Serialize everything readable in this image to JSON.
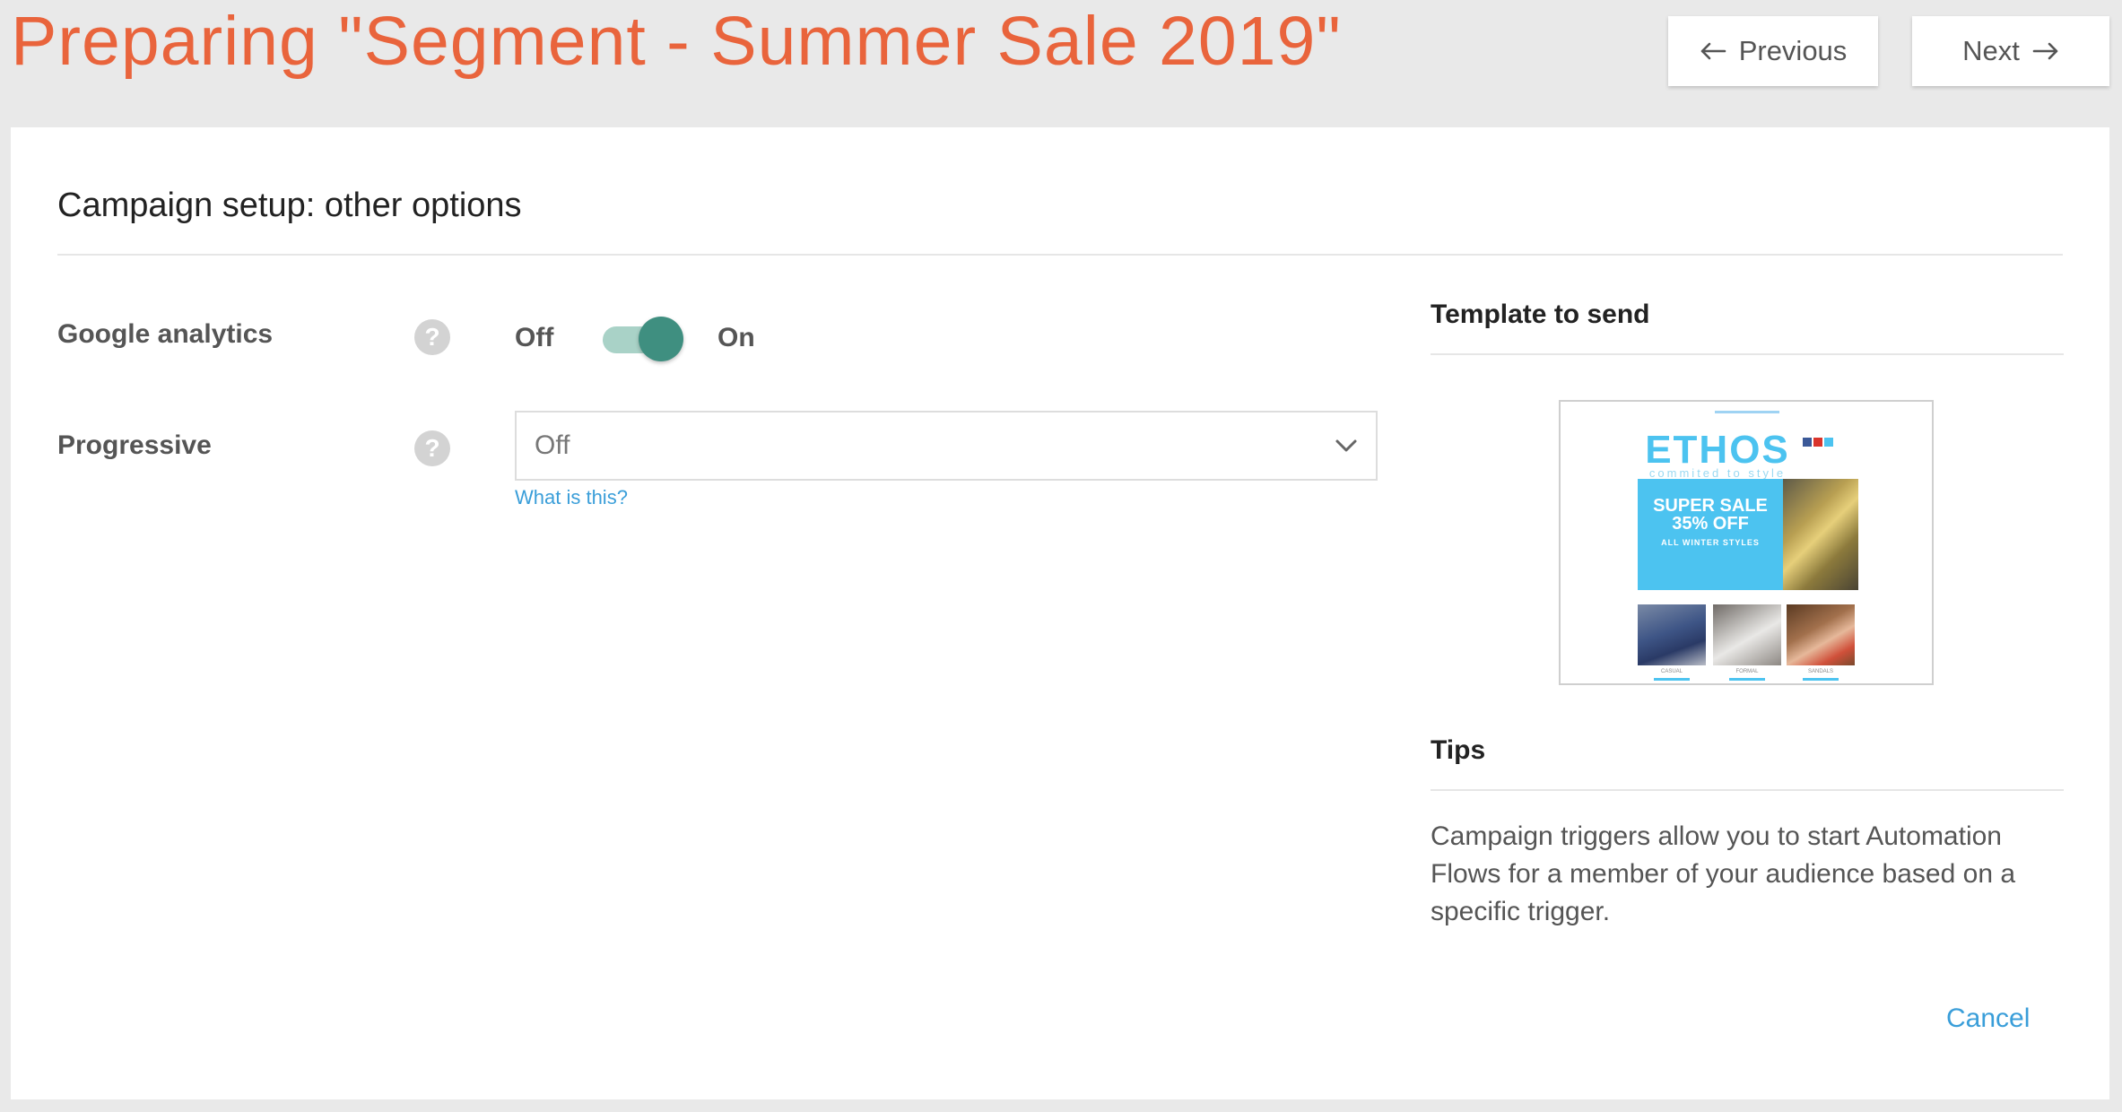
{
  "header": {
    "title": "Preparing \"Segment - Summer Sale 2019\"",
    "previous_label": "Previous",
    "next_label": "Next"
  },
  "section": {
    "title": "Campaign setup: other options"
  },
  "fields": {
    "google_analytics": {
      "label": "Google analytics",
      "help_icon": "?",
      "off_label": "Off",
      "on_label": "On",
      "enabled": true
    },
    "progressive": {
      "label": "Progressive",
      "help_icon": "?",
      "selected_value": "Off",
      "help_link": "What is this?"
    }
  },
  "sidebar": {
    "template_heading": "Template to send",
    "template_preview": {
      "brand": "ETHOS",
      "tagline": "commited to style",
      "hero_line1": "SUPER SALE",
      "hero_line2": "35% OFF",
      "hero_line3": "ALL WINTER STYLES",
      "products": [
        "CASUAL",
        "FORMAL",
        "SANDALS"
      ]
    },
    "tips_heading": "Tips",
    "tips_text": "Campaign triggers allow you to start Automation Flows for a member of your audience based on a specific trigger."
  },
  "footer": {
    "cancel_label": "Cancel"
  },
  "icons": {
    "previous": "arrow-left-icon",
    "next": "arrow-right-icon",
    "help": "question-circle-icon",
    "dropdown": "chevron-down-icon"
  },
  "colors": {
    "title": "#e9643c",
    "link": "#3a9ed9",
    "toggle_knob": "#3f8f80",
    "toggle_track": "#a9d2c7",
    "background": "#e9e9e9"
  }
}
